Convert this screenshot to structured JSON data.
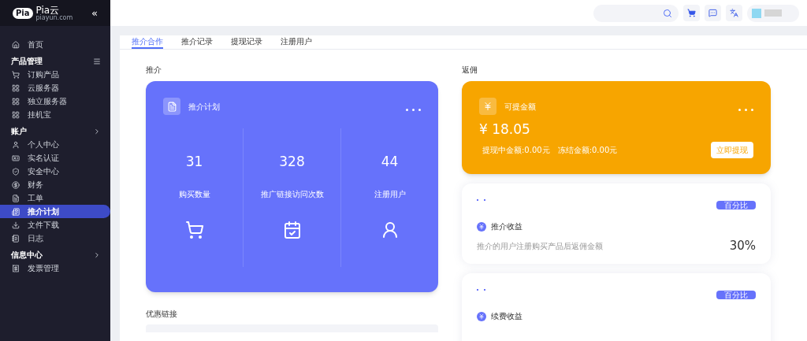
{
  "logo": {
    "badge": "Pia",
    "name": "Pia云",
    "domain": "piayun.com"
  },
  "sidebar": {
    "collapse": "«",
    "sections": [
      {
        "items": [
          {
            "label": "首页",
            "selected": false
          }
        ]
      },
      {
        "title": "产品管理",
        "items": [
          {
            "label": "订购产品",
            "selected": false
          },
          {
            "label": "云服务器",
            "selected": false
          },
          {
            "label": "独立服务器",
            "selected": false
          },
          {
            "label": "挂机宝",
            "selected": false
          }
        ]
      },
      {
        "title": "账户",
        "items": [
          {
            "label": "个人中心",
            "selected": false
          },
          {
            "label": "实名认证",
            "selected": false
          },
          {
            "label": "安全中心",
            "selected": false
          },
          {
            "label": "财务",
            "selected": false
          },
          {
            "label": "工单",
            "selected": false
          },
          {
            "label": "推介计划",
            "selected": true
          },
          {
            "label": "文件下载",
            "selected": false
          },
          {
            "label": "日志",
            "selected": false
          }
        ]
      },
      {
        "title": "信息中心",
        "items": [
          {
            "label": "发票管理",
            "selected": false
          }
        ]
      }
    ]
  },
  "tabs": [
    {
      "label": "推介合作",
      "selected": true
    },
    {
      "label": "推介记录",
      "selected": false
    },
    {
      "label": "提现记录",
      "selected": false
    },
    {
      "label": "注册用户",
      "selected": false
    }
  ],
  "referral": {
    "heading": "推介",
    "card_title": "推介计划",
    "stats": [
      {
        "value": "31",
        "label": "购买数量"
      },
      {
        "value": "328",
        "label": "推广链接访问次数"
      },
      {
        "value": "44",
        "label": "注册用户"
      }
    ]
  },
  "coupon_heading": "优惠链接",
  "commission": {
    "heading": "返佣",
    "card_title": "可提金额",
    "amount": "¥ 18.05",
    "pending": "提现中金额:0.00元",
    "frozen": "冻结金额:0.00元",
    "button": "立即提现"
  },
  "rates": [
    {
      "badge": "百分比",
      "title": "推介收益",
      "description": "推介的用户注册购买产品后返佣金额",
      "value": "30%"
    },
    {
      "badge": "百分比",
      "title": "续费收益"
    }
  ]
}
